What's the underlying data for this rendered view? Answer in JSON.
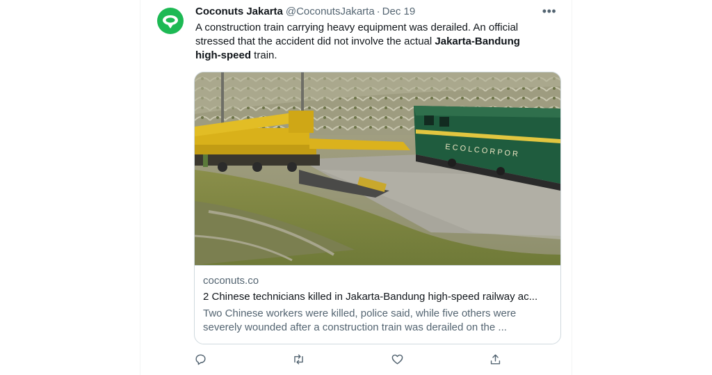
{
  "tweet": {
    "author_name": "Coconuts Jakarta",
    "handle": "@CoconutsJakarta",
    "separator": "·",
    "date": "Dec 19",
    "more_icon": "more-horizontal-icon",
    "text": {
      "line1": "A construction train carrying heavy equipment was derailed. An official",
      "line2": "stressed that the accident did not involve the actual ",
      "bold": "Jakarta-Bandung",
      "bold2": "high-speed",
      "line3_end": " train."
    },
    "avatar": {
      "icon": "coconuts-logo-icon",
      "color": "#1db954"
    }
  },
  "card": {
    "image_description_icon": "derailed-train-photo",
    "domain": "coconuts.co",
    "title": "2 Chinese technicians killed in Jakarta-Bandung high-speed railway ac...",
    "description_line1": "Two Chinese workers were killed, police said, while five others were",
    "description_line2": "severely wounded after a construction train was derailed on the ..."
  },
  "actions": {
    "reply_icon": "reply-icon",
    "retweet_icon": "retweet-icon",
    "like_icon": "like-icon",
    "share_icon": "share-icon"
  },
  "colors": {
    "text": "#0f1419",
    "secondary": "#536471",
    "border": "#cfd9de",
    "brand_green": "#1db954"
  }
}
